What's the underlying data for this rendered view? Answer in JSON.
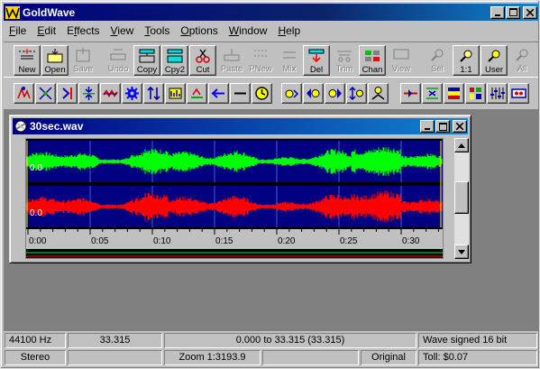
{
  "window": {
    "title": "GoldWave"
  },
  "menu": [
    {
      "label": "File",
      "key": "F",
      "rest": "ile"
    },
    {
      "label": "Edit",
      "key": "E",
      "rest": "dit"
    },
    {
      "label": "Effects",
      "key": "",
      "pre": "E",
      "mid": "f",
      "post": "fects"
    },
    {
      "label": "View",
      "key": "V",
      "rest": "iew"
    },
    {
      "label": "Tools",
      "key": "T",
      "rest": "ools"
    },
    {
      "label": "Options",
      "key": "O",
      "rest": "ptions"
    },
    {
      "label": "Window",
      "key": "W",
      "rest": "indow"
    },
    {
      "label": "Help",
      "key": "H",
      "rest": "elp"
    }
  ],
  "toolbar": {
    "new": "New",
    "open": "Open",
    "save": "Save",
    "undo": "Undo",
    "copy": "Copy",
    "copy2": "Cpy2",
    "cut": "Cut",
    "paste": "Paste",
    "pnew": "PNew",
    "mix": "Mix",
    "del": "Del",
    "trim": "Trim",
    "chan": "Chan",
    "view": "View",
    "sel": "Sel",
    "one_to_one": "1:1",
    "user": "User",
    "all": "All"
  },
  "document": {
    "title": "30sec.wav",
    "channel_labels": [
      "0.0",
      "0.0"
    ],
    "time_ticks": [
      "0:00",
      "0:05",
      "0:10",
      "0:15",
      "0:20",
      "0:25",
      "0:30"
    ],
    "colors": {
      "background": "#000080",
      "left_channel": "#00ff00",
      "right_channel": "#ff0000",
      "cursor": "#ffff00"
    }
  },
  "status": {
    "sample_rate": "44100 Hz",
    "length": "33.315",
    "selection": "0.000 to 33.315  (33.315)",
    "format": "Wave signed 16 bit",
    "channels": "Stereo",
    "zoom": "Zoom 1:3193.9",
    "original": "Original",
    "toll": "Toll: $0.07"
  }
}
